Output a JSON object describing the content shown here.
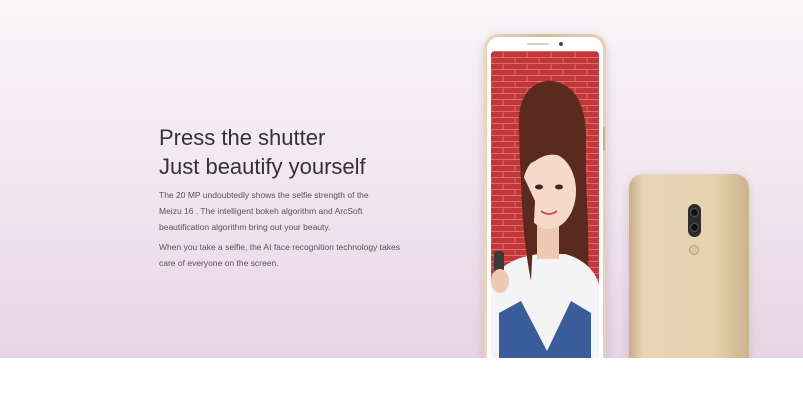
{
  "hero": {
    "headline_line1": "Press the shutter",
    "headline_line2": "Just beautify yourself",
    "paragraph1_line1": "The 20 MP undoubtedly shows the selfie strength of the",
    "paragraph1_line2": "Meizu 16 . The intelligent bokeh algorithm and ArcSoft",
    "paragraph1_line3": "beautification algorithm bring out your beauty.",
    "paragraph2_line1": "When you take a selfie, the AI face recognition technology takes",
    "paragraph2_line2": "care of everyone on the screen."
  },
  "colors": {
    "gradient_top": "#f8f6f8",
    "gradient_bottom": "#e9d4e4",
    "phone_gold": "#e3cfae",
    "screen_red": "#c43b3b",
    "text": "#333333"
  }
}
